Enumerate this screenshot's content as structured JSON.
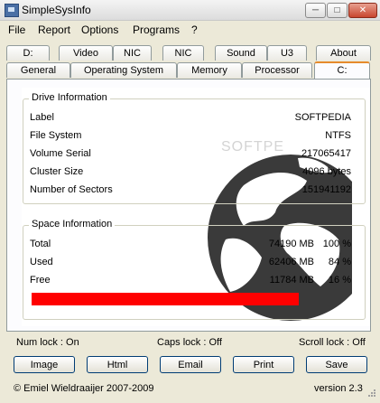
{
  "window": {
    "title": "SimpleSysInfo"
  },
  "menu": [
    "File",
    "Report",
    "Options",
    "Programs",
    "?"
  ],
  "tabs_row1": [
    "D:",
    "Video",
    "NIC",
    "NIC",
    "Sound",
    "U3",
    "About"
  ],
  "tabs_row2": [
    "General",
    "Operating System",
    "Memory",
    "Processor",
    "C:"
  ],
  "drive": {
    "title": "Drive Information",
    "rows": [
      {
        "label": "Label",
        "value": "SOFTPEDIA"
      },
      {
        "label": "File System",
        "value": "NTFS"
      },
      {
        "label": "Volume Serial",
        "value": "217065417"
      },
      {
        "label": "Cluster Size",
        "value": "4096 bytes"
      },
      {
        "label": "Number of Sectors",
        "value": "151941192"
      }
    ]
  },
  "space": {
    "title": "Space Information",
    "rows": [
      {
        "label": "Total",
        "size": "74190 MB",
        "pct": "100 %"
      },
      {
        "label": "Used",
        "size": "62406 MB",
        "pct": "84 %"
      },
      {
        "label": "Free",
        "size": "11784 MB",
        "pct": "16 %"
      }
    ],
    "used_fraction": 0.84,
    "bar_color": "#ff0000"
  },
  "watermark": "SOFTPE",
  "status": {
    "num": "Num lock : On",
    "caps": "Caps lock : Off",
    "scroll": "Scroll lock : Off"
  },
  "buttons": [
    "Image",
    "Html",
    "Email",
    "Print",
    "Save"
  ],
  "footer": {
    "copyright": "© Emiel Wieldraaijer 2007-2009",
    "version": "version 2.3"
  }
}
